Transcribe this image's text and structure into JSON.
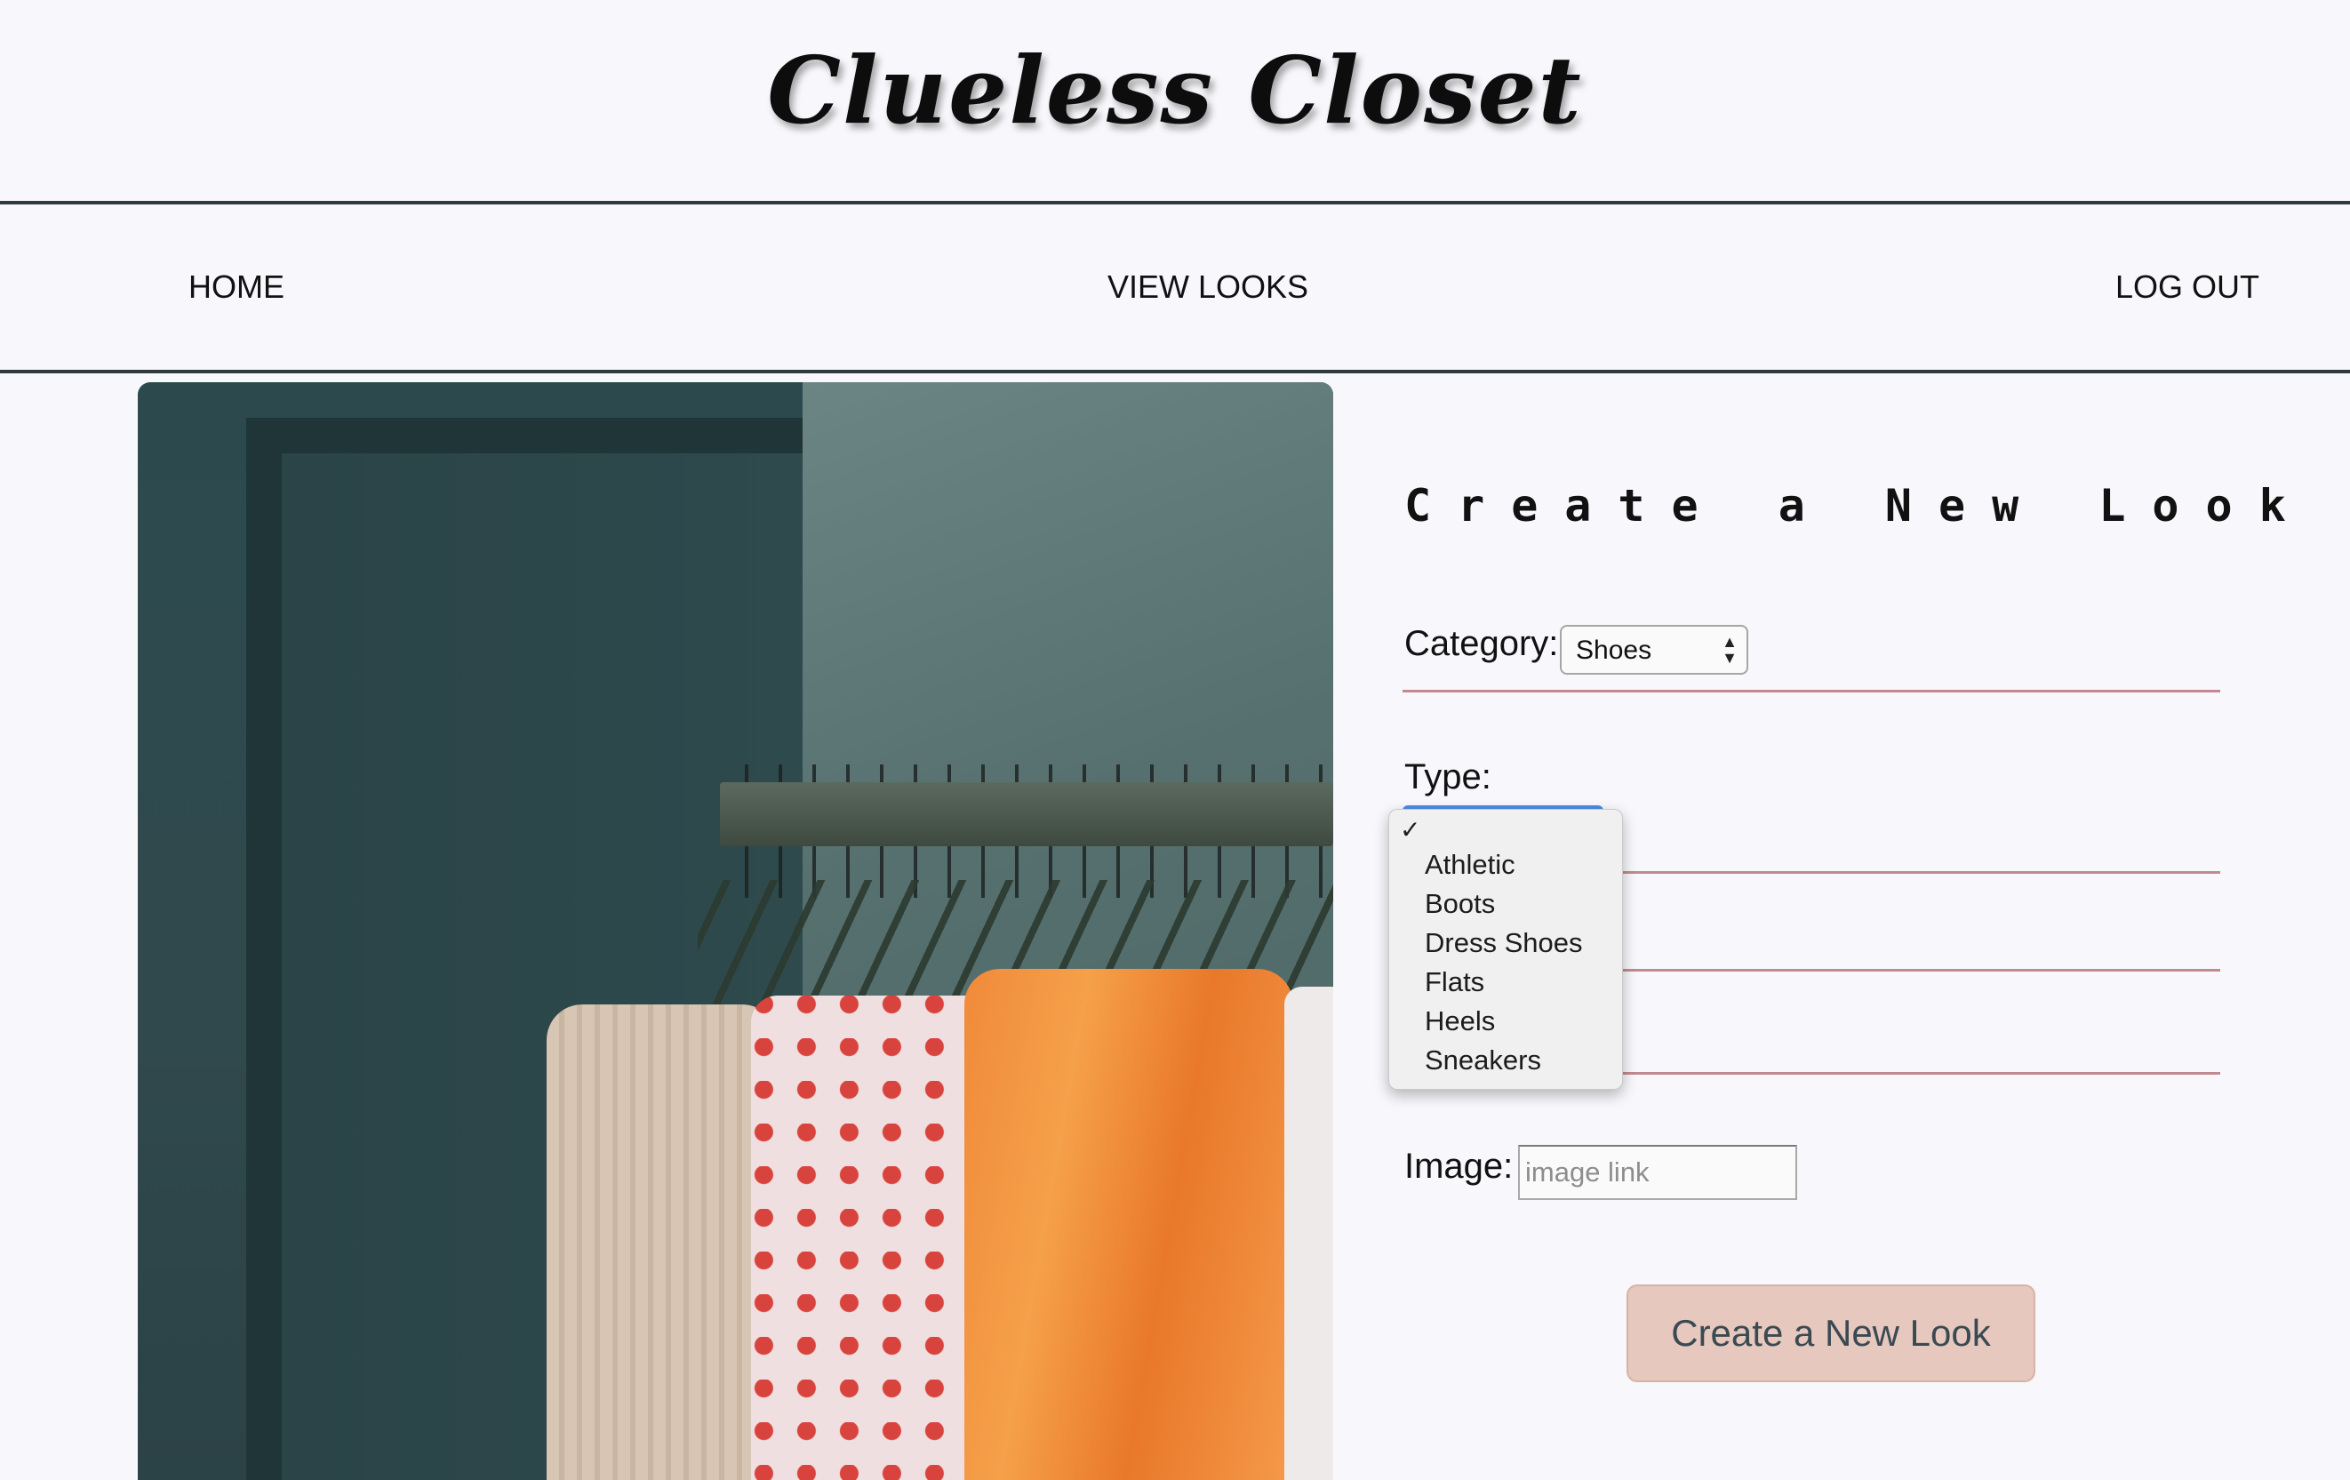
{
  "site": {
    "title": "Clueless Closet"
  },
  "nav": {
    "home": "HOME",
    "view_looks": "VIEW LOOKS",
    "log_out": "LOG OUT"
  },
  "form": {
    "title": "Create a New Look",
    "category_label": "Category:",
    "category_value": "Shoes",
    "type_label": "Type:",
    "type_dropdown": {
      "check_mark": "✓",
      "options": [
        "Athletic",
        "Boots",
        "Dress Shoes",
        "Flats",
        "Heels",
        "Sneakers"
      ]
    },
    "image_label": "Image:",
    "image_placeholder": "image link",
    "submit_label": "Create a New Look"
  },
  "colors": {
    "background": "#f8f8fc",
    "divider": "#c08a8e",
    "button_bg": "#e6c8be",
    "rule": "#2f3b3f"
  }
}
